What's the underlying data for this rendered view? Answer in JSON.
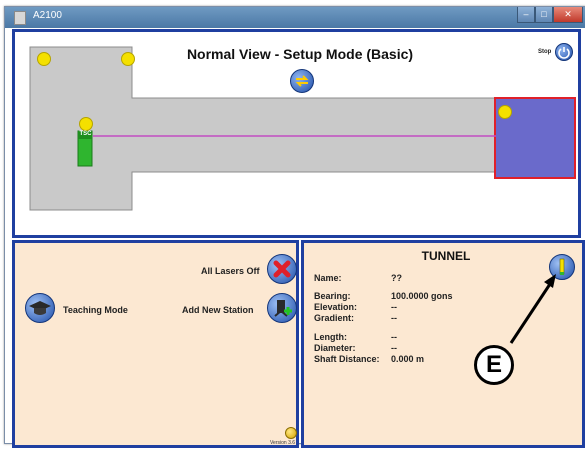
{
  "window": {
    "title": "A2100"
  },
  "map": {
    "title": "Normal View - Setup Mode (Basic)",
    "stop_label": "Stop",
    "tsc_label": "TSC"
  },
  "left_panel": {
    "all_lasers_off": "All Lasers Off",
    "teaching_mode": "Teaching Mode",
    "add_new_station": "Add New Station",
    "version": "Version 3.6"
  },
  "tunnel": {
    "title": "TUNNEL",
    "props": [
      {
        "label": "Name:",
        "value": "??"
      },
      {
        "label": "Bearing:",
        "value": "100.0000 gons"
      },
      {
        "label": "Elevation:",
        "value": "--"
      },
      {
        "label": "Gradient:",
        "value": "--"
      },
      {
        "label": "Length:",
        "value": "--"
      },
      {
        "label": "Diameter:",
        "value": "--"
      },
      {
        "label": "Shaft Distance:",
        "value": "0.000 m"
      }
    ]
  },
  "callout": {
    "letter": "E"
  },
  "colors": {
    "panel_border": "#1f3fa0",
    "panel_bg": "#fce8d2",
    "station_fill": "#6a6acb",
    "station_border": "#e0202a",
    "laser_line": "#c24ec2",
    "marker_yellow": "#f4e000",
    "tsc_green": "#2fb52f"
  }
}
